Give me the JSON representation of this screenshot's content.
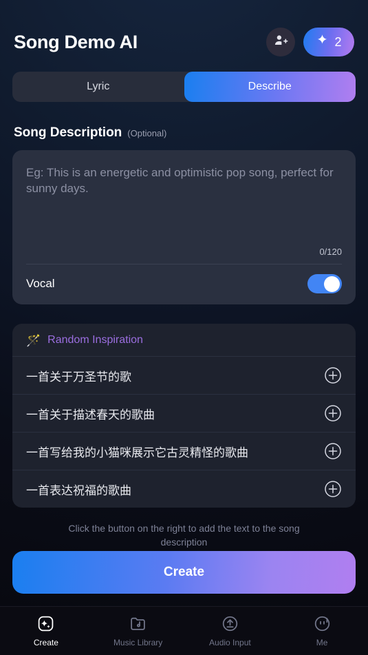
{
  "header": {
    "title": "Song Demo AI",
    "invite_icon": "person-add-icon",
    "credits_icon": "sparkle-icon",
    "credits": "2"
  },
  "tabs": [
    {
      "label": "Lyric",
      "active": false
    },
    {
      "label": "Describe",
      "active": true
    }
  ],
  "description": {
    "title": "Song Description",
    "optional": "(Optional)",
    "placeholder": "Eg: This is an energetic and optimistic pop song, perfect for sunny days.",
    "value": "",
    "counter": "0/120",
    "vocal_label": "Vocal",
    "vocal_on": true
  },
  "inspiration": {
    "icon": "magic-wand-icon",
    "title": "Random Inspiration",
    "items": [
      {
        "text": "一首关于万圣节的歌",
        "add_icon": "plus-circle-icon"
      },
      {
        "text": "一首关于描述春天的歌曲",
        "add_icon": "plus-circle-icon"
      },
      {
        "text": "一首写给我的小猫咪展示它古灵精怪的歌曲",
        "add_icon": "plus-circle-icon"
      },
      {
        "text": "一首表达祝福的歌曲",
        "add_icon": "plus-circle-icon"
      }
    ],
    "hint": "Click the button on the right to add the text to the song description"
  },
  "create_button": {
    "label": "Create"
  },
  "bottom_nav": [
    {
      "label": "Create",
      "icon": "sparkle-square-icon",
      "active": true
    },
    {
      "label": "Music Library",
      "icon": "music-folder-icon",
      "active": false
    },
    {
      "label": "Audio Input",
      "icon": "upload-circle-icon",
      "active": false
    },
    {
      "label": "Me",
      "icon": "profile-circle-icon",
      "active": false
    }
  ],
  "colors": {
    "accent_blue": "#1a7ff0",
    "accent_purple": "#b07ef0",
    "toggle_on": "#4285f4",
    "inspiration_purple": "#9b6ee0"
  }
}
